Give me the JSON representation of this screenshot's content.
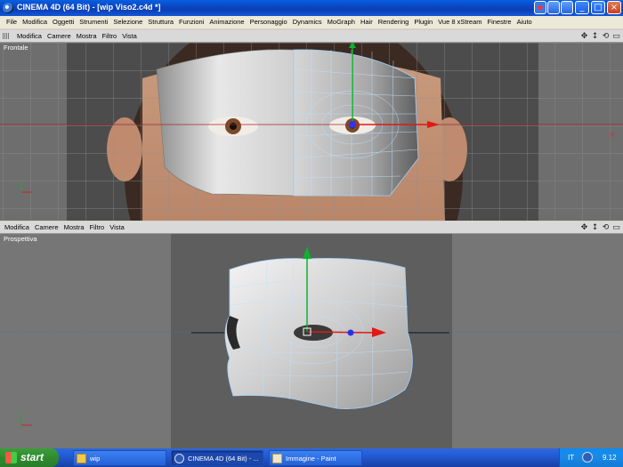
{
  "window": {
    "title": "CINEMA 4D (64 Bit) - [wip Viso2.c4d *]"
  },
  "menu": [
    "File",
    "Modifica",
    "Oggetti",
    "Strumenti",
    "Selezione",
    "Struttura",
    "Funzioni",
    "Animazione",
    "Personaggio",
    "Dynamics",
    "MoGraph",
    "Hair",
    "Rendering",
    "Plugin",
    "Vue 8 xStream",
    "Finestre",
    "Aiuto"
  ],
  "viewport_top": {
    "menu": [
      "Modifica",
      "Camere",
      "Mostra",
      "Filtro",
      "Vista"
    ],
    "label": "Frontale"
  },
  "viewport_bottom": {
    "menu": [
      "Modifica",
      "Camere",
      "Mostra",
      "Filtro",
      "Vista"
    ],
    "label": "Prospettiva"
  },
  "nav_icons": [
    "move-icon",
    "zoom-icon",
    "rotate-icon",
    "maximize-icon"
  ],
  "taskbar": {
    "start": "start",
    "tasks": [
      "wip",
      "CINEMA 4D (64 Bit) - ...",
      "Immagine - Paint"
    ],
    "lang": "IT",
    "clock": "9.12"
  },
  "colors": {
    "title_blue": "#0b46c4",
    "viewport_bg": "#6a6a6a",
    "grid_line": "#8f8f8f",
    "axis_y": "#10b030",
    "axis_x": "#e01818"
  }
}
